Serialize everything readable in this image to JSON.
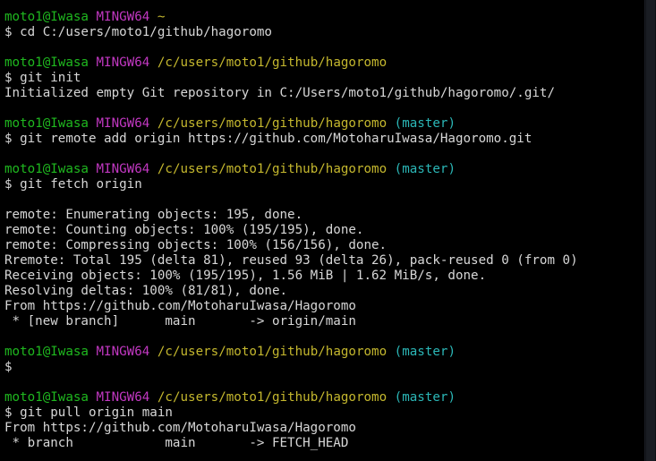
{
  "prompt": {
    "user": "moto1@Iwasa",
    "system": "MINGW64",
    "symbol": "$"
  },
  "lines": [
    {
      "type": "prompt",
      "user": "moto1@Iwasa",
      "system": "MINGW64",
      "path": "~",
      "branch": ""
    },
    {
      "type": "command",
      "text": "$ cd C:/users/moto1/github/hagoromo"
    },
    {
      "type": "blank",
      "text": ""
    },
    {
      "type": "prompt",
      "user": "moto1@Iwasa",
      "system": "MINGW64",
      "path": "/c/users/moto1/github/hagoromo",
      "branch": ""
    },
    {
      "type": "command",
      "text": "$ git init"
    },
    {
      "type": "output",
      "text": "Initialized empty Git repository in C:/Users/moto1/github/hagoromo/.git/"
    },
    {
      "type": "blank",
      "text": ""
    },
    {
      "type": "prompt",
      "user": "moto1@Iwasa",
      "system": "MINGW64",
      "path": "/c/users/moto1/github/hagoromo",
      "branch": "(master)"
    },
    {
      "type": "command",
      "text": "$ git remote add origin https://github.com/MotoharuIwasa/Hagoromo.git"
    },
    {
      "type": "blank",
      "text": ""
    },
    {
      "type": "prompt",
      "user": "moto1@Iwasa",
      "system": "MINGW64",
      "path": "/c/users/moto1/github/hagoromo",
      "branch": "(master)"
    },
    {
      "type": "command",
      "text": "$ git fetch origin"
    },
    {
      "type": "blank",
      "text": ""
    },
    {
      "type": "output",
      "text": "remote: Enumerating objects: 195, done."
    },
    {
      "type": "output",
      "text": "remote: Counting objects: 100% (195/195), done."
    },
    {
      "type": "output",
      "text": "remote: Compressing objects: 100% (156/156), done."
    },
    {
      "type": "output",
      "text": "Rremote: Total 195 (delta 81), reused 93 (delta 26), pack-reused 0 (from 0)"
    },
    {
      "type": "output",
      "text": "Receiving objects: 100% (195/195), 1.56 MiB | 1.62 MiB/s, done."
    },
    {
      "type": "output",
      "text": "Resolving deltas: 100% (81/81), done."
    },
    {
      "type": "output",
      "text": "From https://github.com/MotoharuIwasa/Hagoromo"
    },
    {
      "type": "output",
      "text": " * [new branch]      main       -> origin/main"
    },
    {
      "type": "blank",
      "text": ""
    },
    {
      "type": "prompt",
      "user": "moto1@Iwasa",
      "system": "MINGW64",
      "path": "/c/users/moto1/github/hagoromo",
      "branch": "(master)"
    },
    {
      "type": "command",
      "text": "$"
    },
    {
      "type": "blank",
      "text": ""
    },
    {
      "type": "prompt",
      "user": "moto1@Iwasa",
      "system": "MINGW64",
      "path": "/c/users/moto1/github/hagoromo",
      "branch": "(master)"
    },
    {
      "type": "command",
      "text": "$ git pull origin main"
    },
    {
      "type": "output",
      "text": "From https://github.com/MotoharuIwasa/Hagoromo"
    },
    {
      "type": "output",
      "text": " * branch            main       -> FETCH_HEAD"
    }
  ],
  "colors": {
    "background": "#000000",
    "text": "#d7d7d7",
    "user": "#1fb81f",
    "system": "#c238c2",
    "path": "#c5b82e",
    "branch": "#2bb7b7"
  }
}
